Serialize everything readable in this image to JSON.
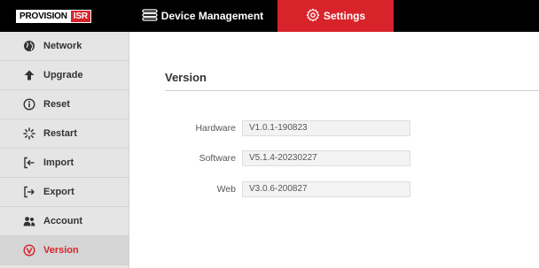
{
  "brand": {
    "name": "PROVISION",
    "accent": "ISR"
  },
  "topnav": {
    "device_management": {
      "label": "Device Management",
      "icon": "device-list-icon"
    },
    "settings": {
      "label": "Settings",
      "icon": "gear-icon",
      "active": true
    }
  },
  "sidebar": {
    "items": [
      {
        "label": "Network",
        "icon": "globe-icon"
      },
      {
        "label": "Upgrade",
        "icon": "arrow-up-icon"
      },
      {
        "label": "Reset",
        "icon": "info-circle-icon"
      },
      {
        "label": "Restart",
        "icon": "spinner-icon"
      },
      {
        "label": "Import",
        "icon": "import-icon"
      },
      {
        "label": "Export",
        "icon": "export-icon"
      },
      {
        "label": "Account",
        "icon": "users-icon"
      },
      {
        "label": "Version",
        "icon": "version-icon",
        "active": true
      }
    ]
  },
  "version": {
    "title": "Version",
    "fields": [
      {
        "label": "Hardware",
        "value": "V1.0.1-190823"
      },
      {
        "label": "Software",
        "value": "V5.1.4-20230227"
      },
      {
        "label": "Web",
        "value": "V3.0.6-200827"
      }
    ]
  },
  "colors": {
    "accent": "#d8232a",
    "topbar": "#000000",
    "sidebar": "#e5e5e5"
  }
}
